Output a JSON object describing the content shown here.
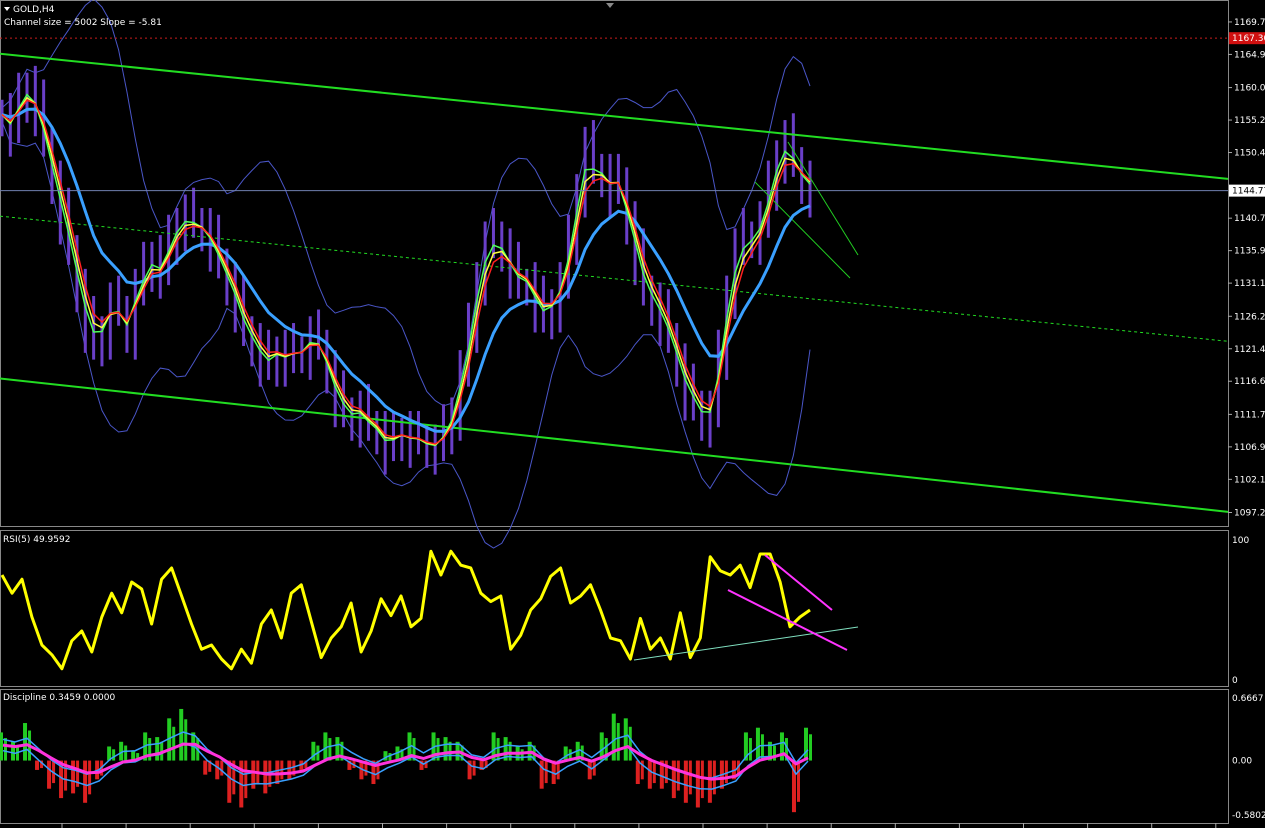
{
  "header": {
    "title": "GOLD,H4",
    "info": "Channel size = 5002 Slope = -5.81"
  },
  "rsi_panel": {
    "label": "RSI(5) 49.9592"
  },
  "disc_panel": {
    "label": "Discipline 0.3459 0.0000"
  },
  "colors": {
    "background": "#000000",
    "candle": "#6a3fc8",
    "ema_green": "#4cff5a",
    "ema_yellow": "#ffff40",
    "ema_red": "#ff2020",
    "ema_blue": "#3aa0ff",
    "bands": "#4a56c8",
    "channel": "#22dd22",
    "rsi": "#ffff00",
    "trend_magenta": "#ff33ff",
    "hist_pos": "#22cc22",
    "hist_neg": "#dd2020"
  },
  "chart_data": [
    {
      "type": "line",
      "title": "GOLD,H4",
      "ylim": [
        1095.5,
        1172.5
      ],
      "y_ticks": [
        "1169.70",
        "1164.90",
        "1160.00",
        "1155.20",
        "1150.40",
        "1140.70",
        "1135.90",
        "1131.10",
        "1126.20",
        "1121.40",
        "1116.60",
        "1111.70",
        "1106.90",
        "1102.10",
        "1097.20"
      ],
      "current_price": "1144.77",
      "alert_price": "1167.30",
      "bar_count": 200,
      "close_series": [
        1156,
        1154,
        1158,
        1160,
        1157,
        1152,
        1146,
        1141,
        1136,
        1130,
        1125,
        1122,
        1124,
        1128,
        1127,
        1124,
        1130,
        1133,
        1135,
        1133,
        1137,
        1140,
        1141,
        1140,
        1139,
        1137,
        1134,
        1131,
        1128,
        1124,
        1122,
        1120,
        1119,
        1121,
        1120,
        1121,
        1121,
        1123,
        1122,
        1118,
        1114,
        1112,
        1111,
        1112,
        1110,
        1109,
        1107,
        1108,
        1109,
        1108,
        1108,
        1107,
        1107,
        1109,
        1112,
        1118,
        1124,
        1132,
        1137,
        1138,
        1136,
        1133,
        1131,
        1131,
        1128,
        1126,
        1128,
        1131,
        1137,
        1145,
        1151,
        1148,
        1147,
        1145,
        1146,
        1140,
        1135,
        1130,
        1128,
        1126,
        1123,
        1119,
        1115,
        1113,
        1111,
        1112,
        1120,
        1130,
        1136,
        1138,
        1138,
        1140,
        1145,
        1150,
        1152,
        1149,
        1146,
        1145
      ],
      "channel": {
        "upper": [
          [
            0,
            1165.0
          ],
          [
            200,
            1146.5
          ]
        ],
        "middle": [
          [
            0,
            1141.0
          ],
          [
            200,
            1122.5
          ]
        ],
        "lower": [
          [
            0,
            1117.0
          ],
          [
            200,
            1097.3
          ]
        ]
      }
    },
    {
      "type": "line",
      "title": "RSI(5) 49.9592",
      "ylim": [
        0,
        100
      ],
      "y_ticks": [
        "100",
        "0"
      ],
      "series": [
        {
          "name": "RSI(5)",
          "values": [
            75,
            62,
            72,
            45,
            25,
            18,
            8,
            28,
            35,
            20,
            45,
            62,
            48,
            70,
            65,
            40,
            72,
            80,
            60,
            40,
            22,
            25,
            15,
            8,
            22,
            12,
            40,
            50,
            30,
            62,
            68,
            42,
            16,
            30,
            38,
            55,
            20,
            35,
            58,
            46,
            60,
            38,
            44,
            92,
            75,
            92,
            82,
            80,
            62,
            56,
            60,
            22,
            32,
            50,
            58,
            74,
            80,
            55,
            60,
            68,
            50,
            30,
            28,
            15,
            44,
            22,
            30,
            15,
            48,
            16,
            30,
            88,
            78,
            75,
            82,
            66,
            90,
            90,
            70,
            38,
            45,
            50
          ]
        }
      ]
    },
    {
      "type": "bar",
      "title": "Discipline 0.3459 0.0000",
      "ylim": [
        -0.5802,
        0.6667
      ],
      "y_ticks": [
        "0.6667",
        "0.00",
        "-0.5802"
      ],
      "series": [
        {
          "name": "histogram",
          "values": [
            0.3,
            0.2,
            0.4,
            -0.1,
            -0.3,
            -0.4,
            -0.35,
            -0.45,
            -0.2,
            0.15,
            0.2,
            0.1,
            0.3,
            0.25,
            0.45,
            0.55,
            0.3,
            -0.15,
            -0.2,
            -0.45,
            -0.5,
            -0.3,
            -0.35,
            -0.25,
            -0.2,
            -0.1,
            0.2,
            0.3,
            0.25,
            -0.1,
            -0.2,
            -0.25,
            0.1,
            0.15,
            0.3,
            -0.1,
            0.3,
            0.25,
            0.2,
            -0.2,
            -0.1,
            0.3,
            0.25,
            0.15,
            0.2,
            -0.3,
            -0.25,
            0.15,
            0.2,
            -0.2,
            0.3,
            0.5,
            0.45,
            -0.25,
            -0.3,
            -0.3,
            -0.4,
            -0.45,
            -0.5,
            -0.45,
            -0.3,
            -0.2,
            0.3,
            0.35,
            0.2,
            0.3,
            -0.55,
            0.35
          ]
        }
      ]
    }
  ]
}
